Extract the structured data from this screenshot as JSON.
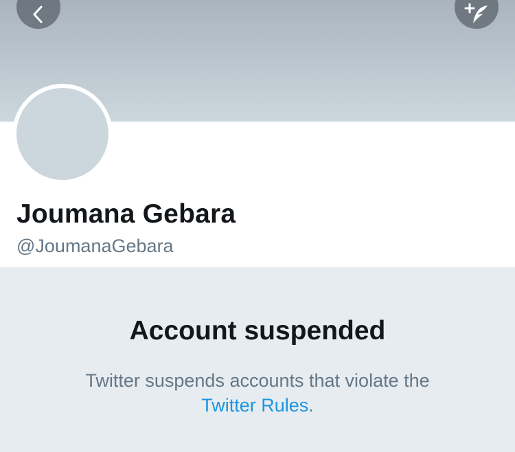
{
  "header": {
    "back_icon": "chevron-left-icon",
    "compose_icon": "compose-tweet-icon"
  },
  "profile": {
    "display_name": "Joumana Gebara",
    "handle": "@JoumanaGebara"
  },
  "suspension": {
    "title": "Account suspended",
    "message": "Twitter suspends accounts that violate the",
    "link_text": "Twitter Rules",
    "trailing_punctuation": "."
  },
  "colors": {
    "link": "#1b95e0",
    "muted_text": "#657786",
    "primary_text": "#14171a",
    "avatar_placeholder": "#ccd6dd",
    "page_background": "#e6ecf0"
  }
}
